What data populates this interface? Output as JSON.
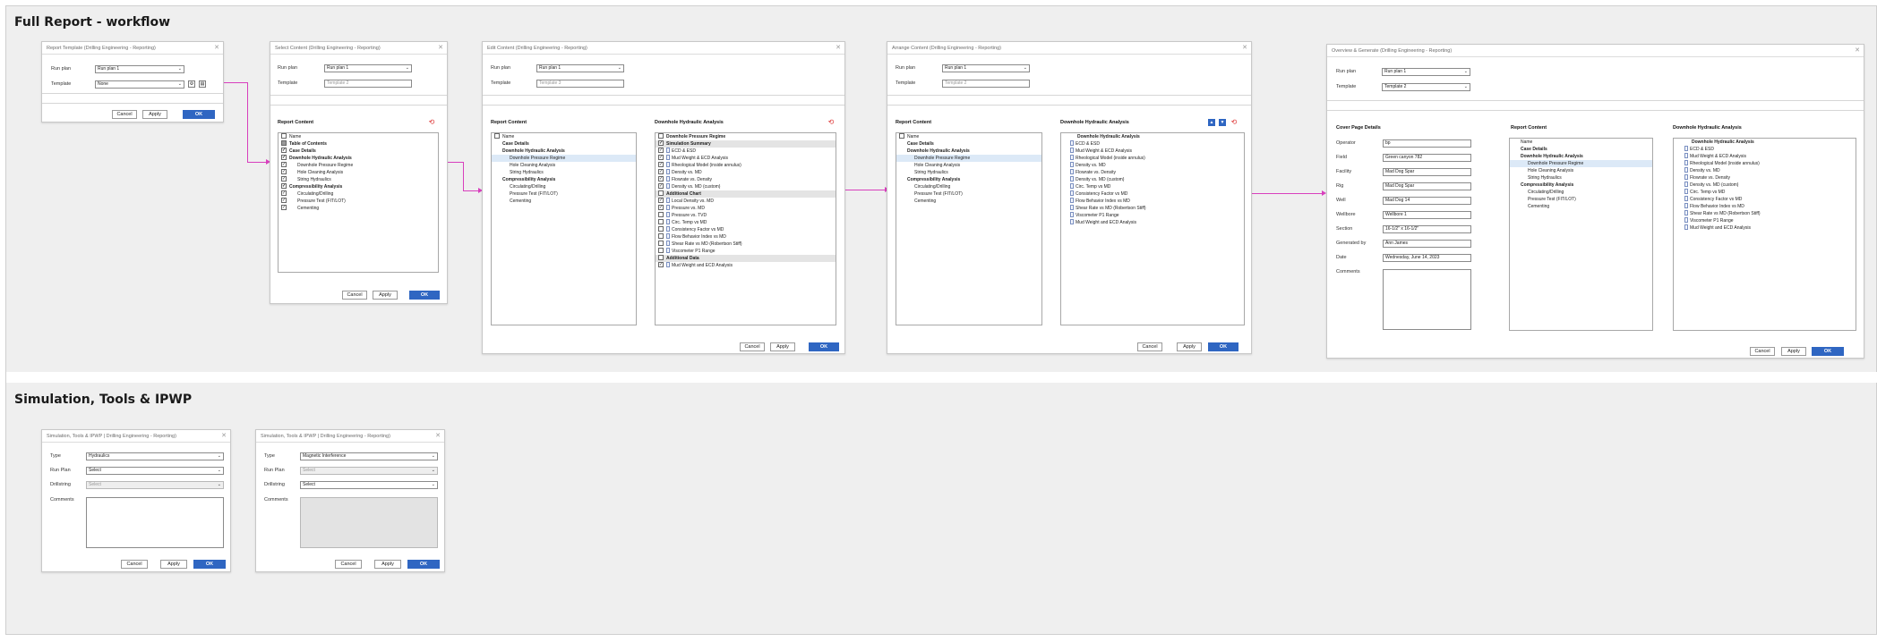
{
  "sections": {
    "full_report": "Full Report - workflow",
    "sim_tools": "Simulation, Tools & IPWP"
  },
  "buttons": {
    "cancel": "Cancel",
    "apply": "Apply",
    "ok": "OK"
  },
  "labels": {
    "run_plan": "Run plan",
    "template": "Template",
    "type": "Type",
    "run_plan2": "Run Plan",
    "drillstring": "Drillstring",
    "comments": "Comments",
    "report_content": "Report Content",
    "dha": "Downhole Hydraulic Analysis",
    "cover_page": "Cover Page Details"
  },
  "d1": {
    "title": "Report Template (Drilling Engineering - Reporting)",
    "run_plan": "Run plan 1",
    "template": "None"
  },
  "d2": {
    "title": "Select Content (Drilling Engineering - Reporting)",
    "run_plan": "Run plan 1",
    "template_ph": "Template 2",
    "tree": [
      "Name",
      "Table of Contents",
      "Case Details",
      "Downhole Hydraulic Analysis",
      "Downhole Pressure Regime",
      "Hole Cleaning Analysis",
      "String Hydraulics",
      "Compressibility Analysis",
      "Circulating/Drilling",
      "Pressure Test (FIT/LOT)",
      "Cementing"
    ]
  },
  "d3": {
    "title": "Edit Content (Drilling Engineering - Reporting)",
    "run_plan": "Run plan 1",
    "template_ph": "Template 3",
    "tree": [
      "Name",
      "Case Details",
      "Downhole Hydraulic Analysis",
      "Downhole Pressure Regime",
      "Hole Cleaning Analysis",
      "String Hydraulics",
      "Compressibility Analysis",
      "Circulating/Drilling",
      "Pressure Test (FIT/LOT)",
      "Cementing"
    ],
    "right": [
      "Downhole Pressure Regime",
      "Simulation Summary",
      "ECD & ESD",
      "Mud Weight & ECD Analysis",
      "Rheological Model (inside annulus)",
      "Density vs. MD",
      "Flowrate vs. Density",
      "Density vs. MD (custom)",
      "Additional Chart",
      "Local Density vs. MD",
      "Pressure vs. MD",
      "Pressure vs. TVD",
      "Circ. Temp vs MD",
      "Consistency Factor vs MD",
      "Flow Behavior Index vs MD",
      "Shear Rate vs MD (Robertson Stiff)",
      "Viscometer P1 Range",
      "Additional Data",
      "Mud Weight and ECD Analysis"
    ]
  },
  "d4": {
    "title": "Arrange Content (Drilling Engineering - Reporting)",
    "run_plan": "Run plan 1",
    "template_ph": "Template 2",
    "right": [
      "Downhole Hydraulic Analysis",
      "ECD & ESD",
      "Mud Weight & ECD Analysis",
      "Rheological Model (inside annulus)",
      "Density vs. MD",
      "Flowrate vs. Density",
      "Density vs. MD (custom)",
      "Circ. Temp vs MD",
      "Consistency Factor vs MD",
      "Flow Behavior Index vs MD",
      "Shear Rate vs MD (Robertson Stiff)",
      "Viscometer P1 Range",
      "Mud Weight and ECD Analysis"
    ]
  },
  "d5": {
    "title": "Overview & Generate (Drilling Engineering - Reporting)",
    "run_plan": "Run plan 1",
    "template": "Template 2",
    "cover": [
      {
        "k": "Operator",
        "v": "bp"
      },
      {
        "k": "Field",
        "v": "Green canyon 782"
      },
      {
        "k": "Facility",
        "v": "Mad Dog Spar"
      },
      {
        "k": "Rig",
        "v": "Mad Dog Spar"
      },
      {
        "k": "Well",
        "v": "Mad Dog 14"
      },
      {
        "k": "Wellbore",
        "v": "Wellbore 1"
      },
      {
        "k": "Section",
        "v": "16-1/2\" x 16-1/2\""
      },
      {
        "k": "Generated by",
        "v": "Ann James"
      },
      {
        "k": "Date",
        "v": "Wednesday, June 14, 2023"
      }
    ],
    "tree": [
      "Name",
      "Case Details",
      "Downhole Hydraulic Analysis",
      "Downhole Pressure Regime",
      "Hole Cleaning Analysis",
      "String Hydraulics",
      "Compressibility Analysis",
      "Circulating/Drilling",
      "Pressure Test (FIT/LOT)",
      "Cementing"
    ]
  },
  "d6": {
    "title": "Simulation, Tools & IPWP | Drilling Engineering - Reporting)",
    "type": "Hydraulics",
    "run_plan": "Select",
    "drillstring": "Select"
  },
  "d7": {
    "title": "Simulation, Tools & IPWP | Drilling Engineering - Reporting)",
    "type": "Magnetic Interference",
    "run_plan": "Select",
    "drillstring": "Select"
  }
}
